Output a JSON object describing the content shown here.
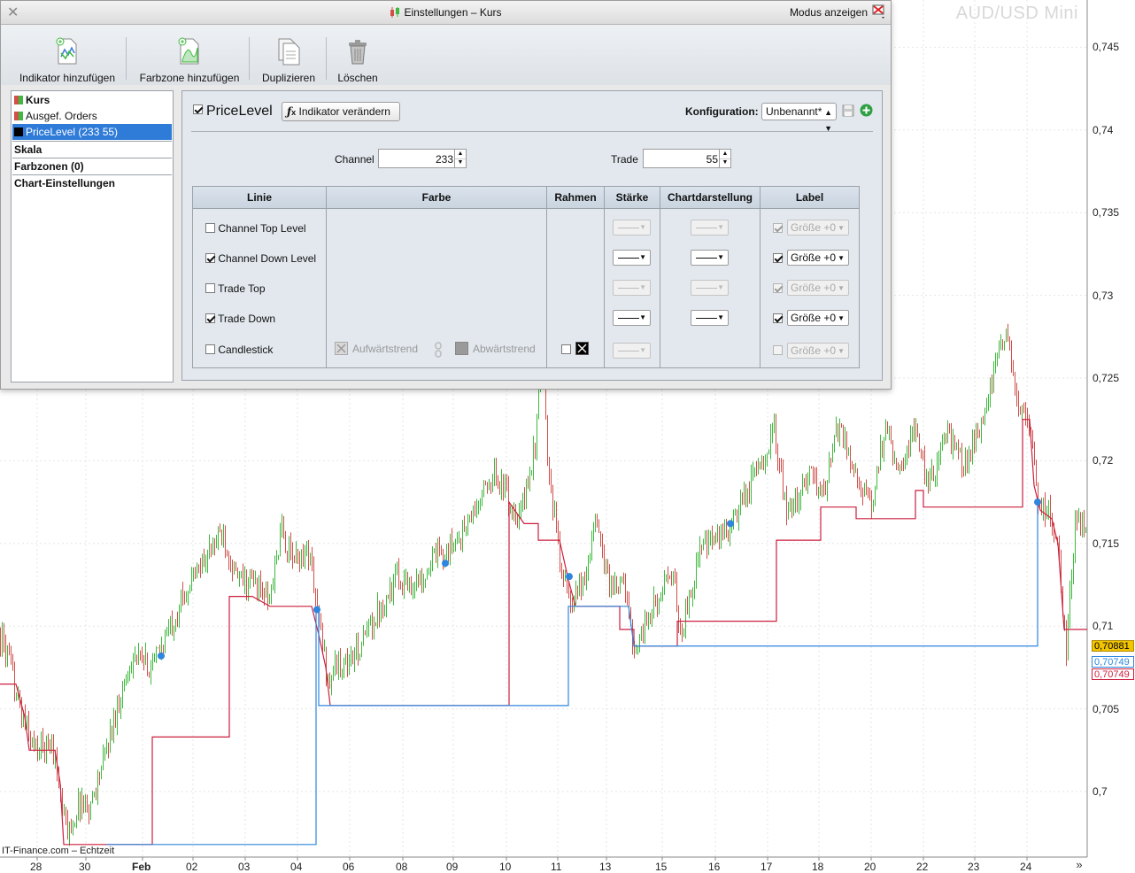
{
  "chart": {
    "instrument": "AUD/USD Mini",
    "y_ticks": [
      {
        "value": 0.745,
        "label": "0,745"
      },
      {
        "value": 0.74,
        "label": "0,74"
      },
      {
        "value": 0.735,
        "label": "0,735"
      },
      {
        "value": 0.73,
        "label": "0,73"
      },
      {
        "value": 0.725,
        "label": "0,725"
      },
      {
        "value": 0.72,
        "label": "0,72"
      },
      {
        "value": 0.715,
        "label": "0,715"
      },
      {
        "value": 0.71,
        "label": "0,71"
      },
      {
        "value": 0.705,
        "label": "0,705"
      },
      {
        "value": 0.7,
        "label": "0,7"
      }
    ],
    "x_ticks": [
      "28",
      "30",
      "Feb",
      "02",
      "03",
      "04",
      "06",
      "08",
      "09",
      "10",
      "11",
      "13",
      "15",
      "16",
      "17",
      "18",
      "20",
      "22",
      "23",
      "24"
    ],
    "price_tags": [
      {
        "value": 0.70881,
        "label": "0,70881",
        "bg": "#f3c400",
        "fg": "#000000"
      },
      {
        "value": 0.70749,
        "label": "0,70749",
        "bg": "#ffffff",
        "fg": "#2e86de"
      },
      {
        "value": 0.70749,
        "label": "0,70749",
        "bg": "#ffffff",
        "fg": "#cc1f3f"
      }
    ],
    "source": "IT-Finance.com – Echtzeit",
    "scroll_glyph": "»",
    "colors": {
      "up": "#3fb93f",
      "down": "#d0504a",
      "trade_down": "#cc1f3f",
      "channel_down": "#2e86de",
      "grid": "#e6e6e6"
    }
  },
  "dialog": {
    "title": "Einstellungen – Kurs",
    "mode_label": "Modus anzeigen",
    "toolbar": [
      {
        "label": "Indikator hinzufügen",
        "icon": "add-indicator-icon"
      },
      {
        "label": "Farbzone hinzufügen",
        "icon": "add-colorzone-icon"
      },
      {
        "label": "Duplizieren",
        "icon": "duplicate-icon"
      },
      {
        "label": "Löschen",
        "icon": "trash-icon"
      }
    ],
    "tree": [
      {
        "label": "Kurs",
        "bold": true,
        "color": "split"
      },
      {
        "label": "Ausgef. Orders",
        "bold": false,
        "color": "split"
      },
      {
        "label": "PriceLevel (233 55)",
        "bold": false,
        "color": "#000000",
        "selected": true
      },
      {
        "label": "Skala",
        "bold": true
      },
      {
        "label": "Farbzonen (0)",
        "bold": true
      },
      {
        "label": "Chart-Einstellungen",
        "bold": true
      }
    ],
    "indicator": {
      "name": "PriceLevel",
      "enabled": true,
      "change_button": "Indikator verändern",
      "config_label": "Konfiguration:",
      "config_value": "Unbenannt*",
      "channel_label": "Channel",
      "channel_value": "233",
      "trade_label": "Trade",
      "trade_value": "55"
    },
    "table": {
      "headers": [
        "Linie",
        "Farbe",
        "Rahmen",
        "Stärke",
        "Chartdarstellung",
        "Label"
      ],
      "rows": [
        {
          "label": "Channel Top Level",
          "checked": false,
          "label_value": "Größe +0"
        },
        {
          "label": "Channel Down Level",
          "checked": true,
          "label_value": "Größe +0"
        },
        {
          "label": "Trade Top",
          "checked": false,
          "label_value": "Größe +0"
        },
        {
          "label": "Trade Down",
          "checked": true,
          "label_value": "Größe +0"
        },
        {
          "label": "Candlestick",
          "checked": false,
          "label_value": "Größe +0"
        }
      ],
      "uptrend_label": "Aufwärtstrend",
      "downtrend_label": "Abwärtstrend"
    }
  }
}
